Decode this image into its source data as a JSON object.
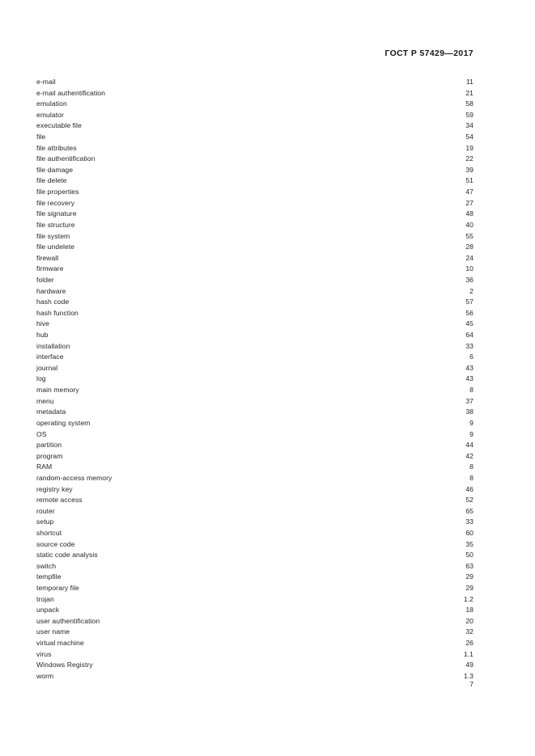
{
  "header": {
    "standard_title": "ГОСТ Р 57429—2017"
  },
  "footer": {
    "page_number": "7"
  },
  "index": {
    "entries": [
      {
        "term": "e-mail",
        "page": "11"
      },
      {
        "term": "e-mail authentification",
        "page": "21"
      },
      {
        "term": "emulation",
        "page": "58"
      },
      {
        "term": "emulator",
        "page": "59"
      },
      {
        "term": "executable file",
        "page": "34"
      },
      {
        "term": "file",
        "page": "54"
      },
      {
        "term": "file attributes",
        "page": "19"
      },
      {
        "term": "file authentification",
        "page": "22"
      },
      {
        "term": "file damage",
        "page": "39"
      },
      {
        "term": "file delete",
        "page": "51"
      },
      {
        "term": "file properties",
        "page": "47"
      },
      {
        "term": "file recovery",
        "page": "27"
      },
      {
        "term": "file signature",
        "page": "48"
      },
      {
        "term": "file structure",
        "page": "40"
      },
      {
        "term": "file system",
        "page": "55"
      },
      {
        "term": "file undelete",
        "page": "28"
      },
      {
        "term": "firewall",
        "page": "24"
      },
      {
        "term": "firmware",
        "page": "10"
      },
      {
        "term": "folder",
        "page": "36"
      },
      {
        "term": "hardware",
        "page": "2"
      },
      {
        "term": "hash code",
        "page": "57"
      },
      {
        "term": "hash function",
        "page": "56"
      },
      {
        "term": "hive",
        "page": "45"
      },
      {
        "term": "hub",
        "page": "64"
      },
      {
        "term": "installation",
        "page": "33"
      },
      {
        "term": "interface",
        "page": "6"
      },
      {
        "term": "journal",
        "page": "43"
      },
      {
        "term": "log",
        "page": "43"
      },
      {
        "term": "main memory",
        "page": "8"
      },
      {
        "term": "menu",
        "page": "37"
      },
      {
        "term": "metadata",
        "page": "38"
      },
      {
        "term": "operating system",
        "page": "9"
      },
      {
        "term": "OS",
        "page": "9"
      },
      {
        "term": "partition",
        "page": "44"
      },
      {
        "term": "program",
        "page": "42"
      },
      {
        "term": "RAM",
        "page": "8"
      },
      {
        "term": "random-access memory",
        "page": "8"
      },
      {
        "term": "registry key",
        "page": "46"
      },
      {
        "term": "remote access",
        "page": "52"
      },
      {
        "term": "router",
        "page": "65"
      },
      {
        "term": "setup",
        "page": "33"
      },
      {
        "term": "shortcut",
        "page": "60"
      },
      {
        "term": "source code",
        "page": "35"
      },
      {
        "term": "static code analysis",
        "page": "50"
      },
      {
        "term": "switch",
        "page": "63"
      },
      {
        "term": "tempfile",
        "page": "29"
      },
      {
        "term": "temporary file",
        "page": "29"
      },
      {
        "term": "trojan",
        "page": "1.2"
      },
      {
        "term": "unpack",
        "page": "18"
      },
      {
        "term": "user authentification",
        "page": "20"
      },
      {
        "term": "user name",
        "page": "32"
      },
      {
        "term": "virtual machine",
        "page": "26"
      },
      {
        "term": "virus",
        "page": "1.1"
      },
      {
        "term": "Windows Registry",
        "page": "49"
      },
      {
        "term": "worm",
        "page": "1.3"
      }
    ]
  }
}
